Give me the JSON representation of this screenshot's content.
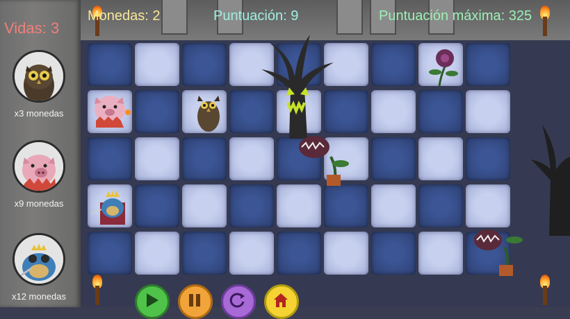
{
  "hud": {
    "coins": "Monedas: 2",
    "score": "Puntuación: 9",
    "best": "Puntuación máxima: 325"
  },
  "sidebar": {
    "lives": "Vidas: 3",
    "units": [
      {
        "cost": "x3 monedas",
        "icon": "owl-icon"
      },
      {
        "cost": "x9 monedas",
        "icon": "pig-icon"
      },
      {
        "cost": "x12 monedas",
        "icon": "frog-king-icon"
      }
    ]
  },
  "controls": [
    {
      "name": "play-button",
      "icon": "play-icon"
    },
    {
      "name": "pause-button",
      "icon": "pause-icon"
    },
    {
      "name": "restart-button",
      "icon": "restart-icon"
    },
    {
      "name": "home-button",
      "icon": "home-icon"
    }
  ],
  "colors": {
    "lives": "#f08078",
    "coins": "#f7e69a",
    "score": "#9ff0e0",
    "best": "#9df0b6"
  }
}
